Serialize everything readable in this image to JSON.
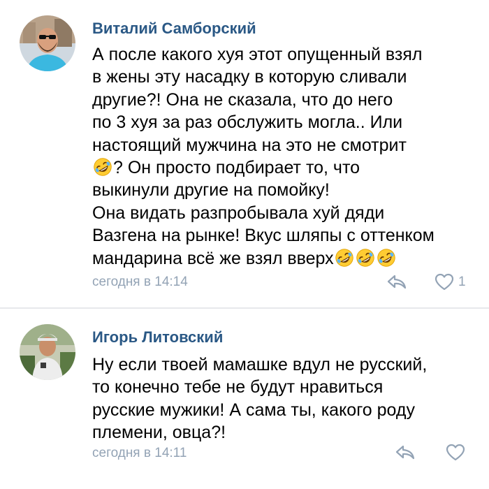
{
  "comments": [
    {
      "author": "Виталий Самборский",
      "lines": [
        "А после какого хуя этот опущенный взял",
        "в жены эту насадку в которую сливали",
        "другие?! Она не сказала, что до него",
        "по 3 хуя за раз обслужить могла.. Или",
        "настоящий мужчина на это не смотрит",
        "? Он просто подбирает то, что",
        "выкинули другие на помойку!",
        "Она видать разпробывала хуй дяди",
        "Вазгена на рынке! Вкус шляпы с оттенком",
        "мандарина всё же взял вверх"
      ],
      "time": "сегодня в 14:14",
      "likes": "1",
      "emoji": "rolling-on-floor-laughing"
    },
    {
      "author": "Игорь Литовский",
      "lines": [
        "Ну если твоей мамашке вдул не русский,",
        "то конечно тебе не будут нравиться",
        "русские мужики! А сама ты, какого роду",
        "племени, овца?!"
      ],
      "time": "сегодня в 14:11"
    }
  ],
  "colors": {
    "author": "#2a5885",
    "meta": "#93a3b5",
    "divider": "#e7e8ec"
  },
  "icons": [
    "reply-icon",
    "heart-icon",
    "laughing-emoji-icon"
  ]
}
